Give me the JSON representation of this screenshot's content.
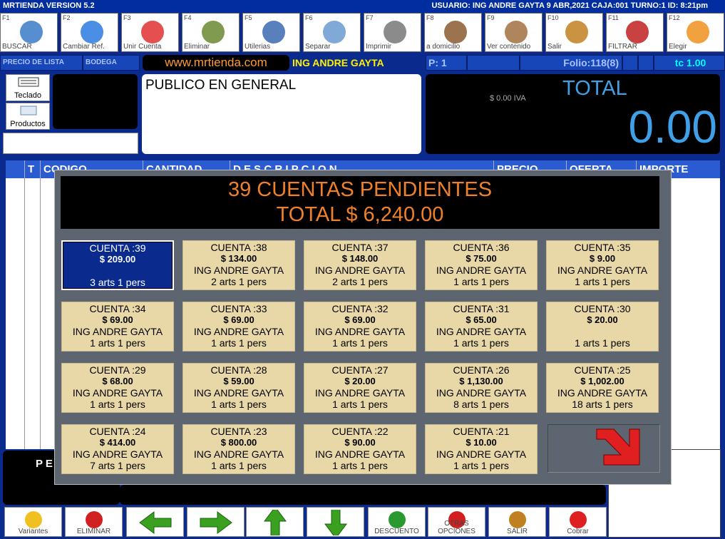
{
  "titlebar": {
    "app": "MRTIENDA VERSION 5.2",
    "status": "USUARIO: ING ANDRE GAYTA  9 ABR,2021 CAJA:001 TURNO:1 ID:  8:21pm"
  },
  "fkeys": [
    {
      "key": "F1",
      "label": "BUSCAR",
      "icon": "magnifier-icon"
    },
    {
      "key": "F2",
      "label": "Cambiar Ref.",
      "icon": "refresh-icon"
    },
    {
      "key": "F3",
      "label": "Unir Cuenta",
      "icon": "heart-plus-icon"
    },
    {
      "key": "F4",
      "label": "Eliminar",
      "icon": "scissors-icon"
    },
    {
      "key": "F5",
      "label": "Utilerias",
      "icon": "paperclip-icon"
    },
    {
      "key": "F6",
      "label": "Separar",
      "icon": "document-icon"
    },
    {
      "key": "F7",
      "label": "Imprimir",
      "icon": "printer-icon"
    },
    {
      "key": "F8",
      "label": "a domicilio",
      "icon": "house-icon"
    },
    {
      "key": "F9",
      "label": "Ver contenido",
      "icon": "search-box-icon"
    },
    {
      "key": "F10",
      "label": "Salir",
      "icon": "exit-door-icon"
    },
    {
      "key": "F11",
      "label": "FILTRAR",
      "icon": "filter-printer-icon"
    },
    {
      "key": "F12",
      "label": "Elegir",
      "icon": "check-icon"
    }
  ],
  "info": {
    "precio": "PRECIO DE LISTA",
    "bodega": "BODEGA",
    "web": "www.mrtienda.com",
    "user": "ING ANDRE GAYTA",
    "p": "P:  1",
    "folio": "Folio:118(8)",
    "tc": "tc 1.00"
  },
  "tools": {
    "teclado": "Teclado",
    "productos": "Productos"
  },
  "cliente": "PUBLICO EN GENERAL",
  "total": {
    "label": "TOTAL",
    "iva": "$ 0.00 IVA",
    "amount": "0.00"
  },
  "grid": {
    "headers": [
      "T",
      "CODIGO",
      "CANTIDAD",
      "D E S C R I P C I O N",
      "PRECIO",
      "OFERTA",
      "IMPORTE"
    ]
  },
  "left_bottom": "P E",
  "modal": {
    "title": "39 CUENTAS PENDIENTES",
    "total": "TOTAL $ 6,240.00",
    "cards": [
      {
        "cuenta": "CUENTA  :39",
        "monto": "$ 209.00",
        "user": "",
        "arts": "3 arts  1 pers",
        "selected": true
      },
      {
        "cuenta": "CUENTA  :38",
        "monto": "$ 134.00",
        "user": "ING ANDRE GAYTA",
        "arts": "2 arts  1 pers"
      },
      {
        "cuenta": "CUENTA  :37",
        "monto": "$ 148.00",
        "user": "ING ANDRE GAYTA",
        "arts": "2 arts  1 pers"
      },
      {
        "cuenta": "CUENTA  :36",
        "monto": "$ 75.00",
        "user": "ING ANDRE GAYTA",
        "arts": "1 arts  1 pers"
      },
      {
        "cuenta": "CUENTA  :35",
        "monto": "$ 9.00",
        "user": "ING ANDRE GAYTA",
        "arts": "1 arts  1 pers"
      },
      {
        "cuenta": "CUENTA  :34",
        "monto": "$ 69.00",
        "user": "ING ANDRE GAYTA",
        "arts": "1 arts  1 pers"
      },
      {
        "cuenta": "CUENTA  :33",
        "monto": "$ 69.00",
        "user": "ING ANDRE GAYTA",
        "arts": "1 arts  1 pers"
      },
      {
        "cuenta": "CUENTA  :32",
        "monto": "$ 69.00",
        "user": "ING ANDRE GAYTA",
        "arts": "1 arts  1 pers"
      },
      {
        "cuenta": "CUENTA  :31",
        "monto": "$ 65.00",
        "user": "ING ANDRE GAYTA",
        "arts": "1 arts  1 pers"
      },
      {
        "cuenta": "CUENTA  :30",
        "monto": "$ 20.00",
        "user": "",
        "arts": "1 arts  1 pers"
      },
      {
        "cuenta": "CUENTA  :29",
        "monto": "$ 68.00",
        "user": "ING ANDRE GAYTA",
        "arts": "1 arts  1 pers"
      },
      {
        "cuenta": "CUENTA  :28",
        "monto": "$ 59.00",
        "user": "ING ANDRE GAYTA",
        "arts": "1 arts  1 pers"
      },
      {
        "cuenta": "CUENTA  :27",
        "monto": "$ 20.00",
        "user": "ING ANDRE GAYTA",
        "arts": "1 arts  1 pers"
      },
      {
        "cuenta": "CUENTA  :26",
        "monto": "$ 1,130.00",
        "user": "ING ANDRE GAYTA",
        "arts": "8 arts  1 pers"
      },
      {
        "cuenta": "CUENTA  :25",
        "monto": "$ 1,002.00",
        "user": "ING ANDRE GAYTA",
        "arts": "18 arts  1 pers"
      },
      {
        "cuenta": "CUENTA  :24",
        "monto": "$ 414.00",
        "user": "ING ANDRE GAYTA",
        "arts": "7 arts  1 pers"
      },
      {
        "cuenta": "CUENTA  :23",
        "monto": "$ 800.00",
        "user": "ING ANDRE GAYTA",
        "arts": "1 arts  1 pers"
      },
      {
        "cuenta": "CUENTA  :22",
        "monto": "$ 90.00",
        "user": "ING ANDRE GAYTA",
        "arts": "1 arts  1 pers"
      },
      {
        "cuenta": "CUENTA  :21",
        "monto": "$ 10.00",
        "user": "ING ANDRE GAYTA",
        "arts": "1 arts  1 pers"
      }
    ]
  },
  "bottom": [
    {
      "label": "Variantes",
      "icon": "highlighter-icon"
    },
    {
      "label": "ELIMINAR",
      "icon": "no-entry-icon"
    },
    {
      "label": "",
      "icon": "arrow-left-icon"
    },
    {
      "label": "",
      "icon": "arrow-right-icon"
    },
    {
      "label": "",
      "icon": "arrow-up-icon"
    },
    {
      "label": "",
      "icon": "arrow-down-icon"
    },
    {
      "label": "DESCUENTO",
      "icon": "percent-icon"
    },
    {
      "label": "OTRAS OPCIONES",
      "icon": "pushpin-icon"
    },
    {
      "label": "SALIR",
      "icon": "exit-door-icon"
    },
    {
      "label": "Cobrar",
      "icon": "basket-icon"
    }
  ]
}
